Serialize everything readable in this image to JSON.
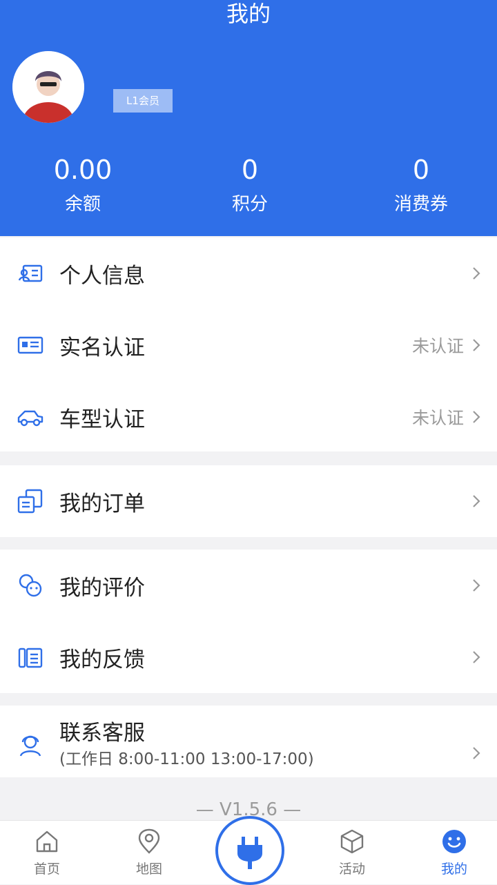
{
  "header": {
    "title": "我的",
    "level_badge": "L1会员",
    "stats": [
      {
        "value": "0.00",
        "label": "余额"
      },
      {
        "value": "0",
        "label": "积分"
      },
      {
        "value": "0",
        "label": "消费券"
      }
    ]
  },
  "sections": {
    "personal_info": {
      "label": "个人信息",
      "icon": "profile-card-icon"
    },
    "real_name": {
      "label": "实名认证",
      "status": "未认证",
      "icon": "id-card-icon"
    },
    "car_model": {
      "label": "车型认证",
      "status": "未认证",
      "icon": "car-icon"
    },
    "orders": {
      "label": "我的订单",
      "icon": "orders-icon"
    },
    "reviews": {
      "label": "我的评价",
      "icon": "review-icon"
    },
    "feedback": {
      "label": "我的反馈",
      "icon": "feedback-icon"
    },
    "service": {
      "label": "联系客服",
      "hours": "(工作日 8:00-11:00 13:00-17:00)",
      "icon": "customer-service-icon"
    }
  },
  "version": "— V1.5.6 —",
  "tabbar": {
    "tabs": [
      {
        "label": "首页",
        "icon": "home-icon"
      },
      {
        "label": "地图",
        "icon": "map-pin-icon"
      },
      {
        "label": "",
        "icon": "charging-plug-icon"
      },
      {
        "label": "活动",
        "icon": "box-icon"
      },
      {
        "label": "我的",
        "icon": "smiley-icon"
      }
    ],
    "active": "我的"
  },
  "colors": {
    "primary": "#2f6fe8",
    "background": "#f2f2f4",
    "muted_text": "#9a9a9a"
  }
}
